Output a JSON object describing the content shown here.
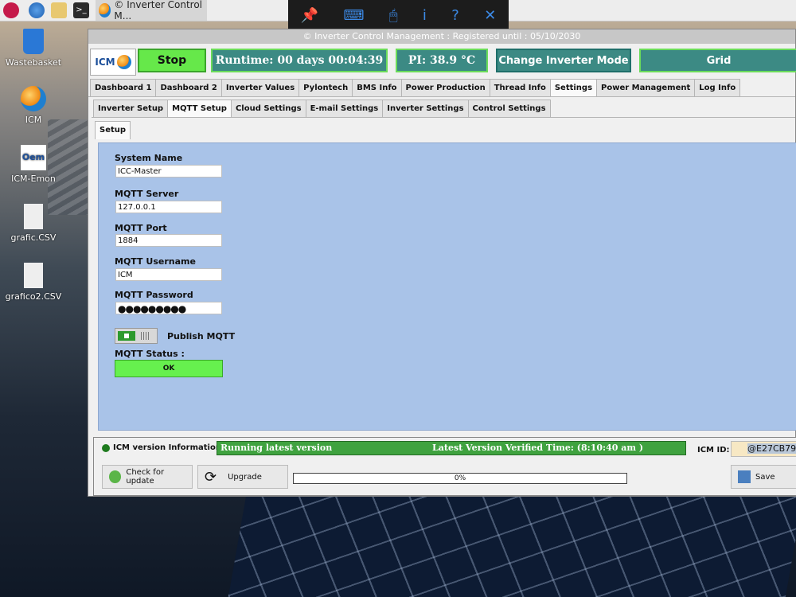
{
  "taskbar": {
    "task_title": "© Inverter Control M..."
  },
  "desktop": {
    "icons": [
      {
        "label": "Wastebasket"
      },
      {
        "label": "ICM"
      },
      {
        "label": "ICM-Emon"
      },
      {
        "label": "grafic.CSV"
      },
      {
        "label": "grafico2.CSV"
      }
    ]
  },
  "window": {
    "title": "© Inverter Control Management : Registered until : 05/10/2030",
    "logo": "ICM",
    "buttons": {
      "stop": "Stop",
      "runtime": "Runtime: 00 days 00:04:39",
      "pi": "PI: 38.9 °C",
      "change_mode": "Change Inverter Mode",
      "grid": "Grid"
    },
    "main_tabs": [
      "Dashboard 1",
      "Dashboard 2",
      "Inverter Values",
      "Pylontech",
      "BMS Info",
      "Power Production",
      "Thread Info",
      "Settings",
      "Power Management",
      "Log Info"
    ],
    "sub_tabs": [
      "Inverter Setup",
      "MQTT Setup",
      "Cloud Settings",
      "E-mail Settings",
      "Inverter Settings",
      "Control Settings"
    ],
    "inner_tab": "Setup",
    "form": {
      "system_name_label": "System Name",
      "system_name": "ICC-Master",
      "server_label": "MQTT Server",
      "server": "127.0.0.1",
      "port_label": "MQTT Port",
      "port": "1884",
      "username_label": "MQTT Username",
      "username": "ICM",
      "password_label": "MQTT Password",
      "password": "●●●●●●●●●",
      "publish_label": "Publish MQTT",
      "status_label": "MQTT Status :",
      "status": "OK"
    },
    "bottom": {
      "version_label": "ICM version Information",
      "version_status": "Running latest version",
      "verified_time": "Latest Version Verified Time: (8:10:40 am )",
      "check_button": "Check for update",
      "upgrade_button": "Upgrade",
      "progress_text": "0%",
      "progress_value": 0,
      "icm_id_label": "ICM ID:",
      "icm_id": "@E27CB79",
      "save_button": "Save"
    }
  }
}
